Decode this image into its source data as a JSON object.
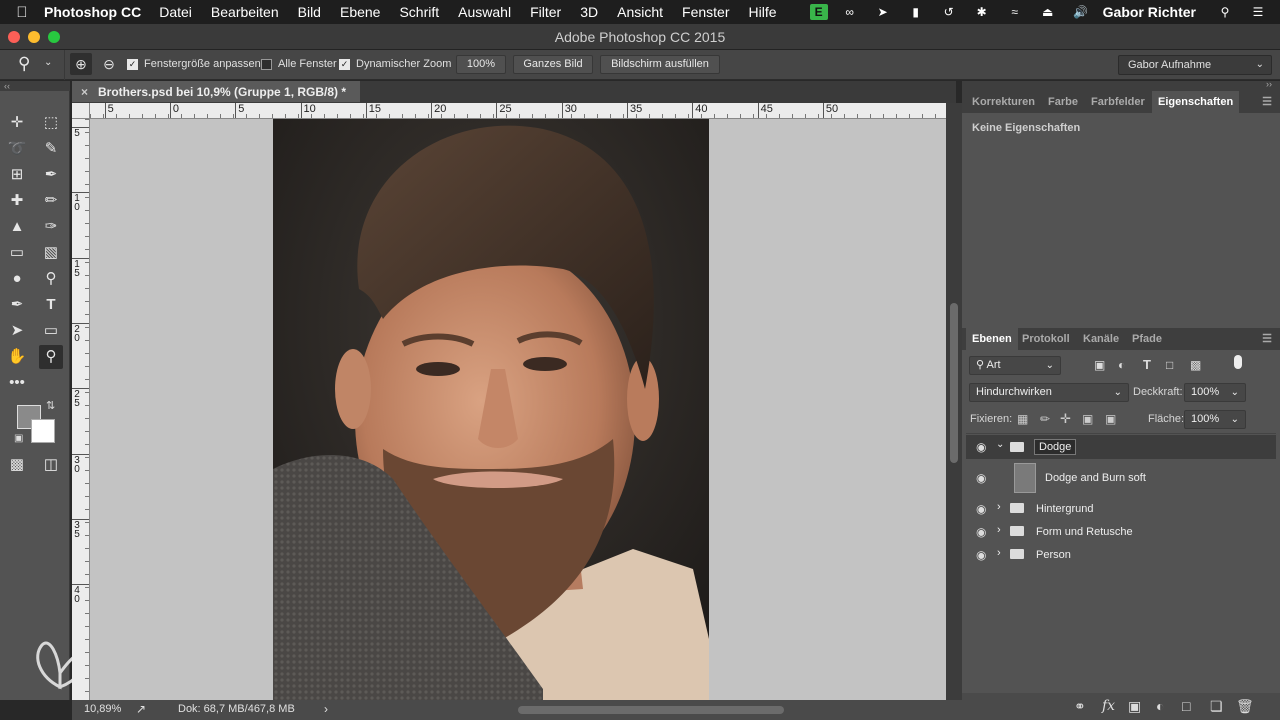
{
  "menubar": {
    "app_name": "Photoshop CC",
    "items": [
      "Datei",
      "Bearbeiten",
      "Bild",
      "Ebene",
      "Schrift",
      "Auswahl",
      "Filter",
      "3D",
      "Ansicht",
      "Fenster",
      "Hilfe"
    ],
    "user": "Gabor Richter",
    "status_icons": [
      "evernote-icon",
      "infinity-icon",
      "cast-icon",
      "battery-icon",
      "time-machine-icon",
      "bluetooth-icon",
      "wifi-icon",
      "eject-icon",
      "volume-icon"
    ]
  },
  "window": {
    "title": "Adobe Photoshop CC 2015"
  },
  "options_bar": {
    "fit_window_label": "Fenstergröße anpassen",
    "fit_window_checked": true,
    "all_windows_label": "Alle Fenster",
    "all_windows_checked": false,
    "scrubby_zoom_label": "Dynamischer Zoom",
    "scrubby_zoom_checked": true,
    "zoom_100_label": "100%",
    "fit_screen_label": "Ganzes Bild",
    "fill_screen_label": "Bildschirm ausfüllen",
    "workspace": "Gabor Aufnahme"
  },
  "document": {
    "tab_title": "Brothers.psd bei 10,9% (Gruppe 1, RGB/8) *",
    "zoom": "10,89%",
    "doc_size": "Dok: 68,7 MB/467,8 MB"
  },
  "rulers": {
    "horizontal_ticks": [
      "5",
      "10",
      "5",
      "0",
      "5",
      "10",
      "15",
      "20",
      "25",
      "30",
      "35",
      "40",
      "45",
      "50"
    ],
    "vertical_ticks": [
      "5",
      "1\n0",
      "1\n5",
      "2\n0",
      "2\n5",
      "3\n0",
      "3\n5",
      "4\n0"
    ]
  },
  "properties_panel": {
    "tabs": [
      "Korrekturen",
      "Farbe",
      "Farbfelder",
      "Eigenschaften"
    ],
    "active_tab": "Eigenschaften",
    "empty_text": "Keine Eigenschaften"
  },
  "layers_panel": {
    "tabs": [
      "Ebenen",
      "Protokoll",
      "Kanäle",
      "Pfade"
    ],
    "active_tab": "Ebenen",
    "filter_kind": "Art",
    "blend_mode": "Hindurchwirken",
    "opacity_label": "Deckkraft:",
    "opacity_value": "100%",
    "lock_label": "Fixieren:",
    "fill_label": "Fläche:",
    "fill_value": "100%",
    "layers": [
      {
        "name": "Dodge",
        "type": "group",
        "expanded": true,
        "selected": true,
        "editing": true
      },
      {
        "name": "Dodge and Burn soft",
        "type": "layer",
        "thumbnail": true
      },
      {
        "name": "Hintergrund",
        "type": "group",
        "expanded": false
      },
      {
        "name": "Form und Retusche",
        "type": "group",
        "expanded": false
      },
      {
        "name": "Person",
        "type": "group",
        "expanded": false
      }
    ]
  },
  "colors": {
    "foreground": "#8a8a8a",
    "background": "#ffffff",
    "selected_layer": "#3d3d3d"
  }
}
